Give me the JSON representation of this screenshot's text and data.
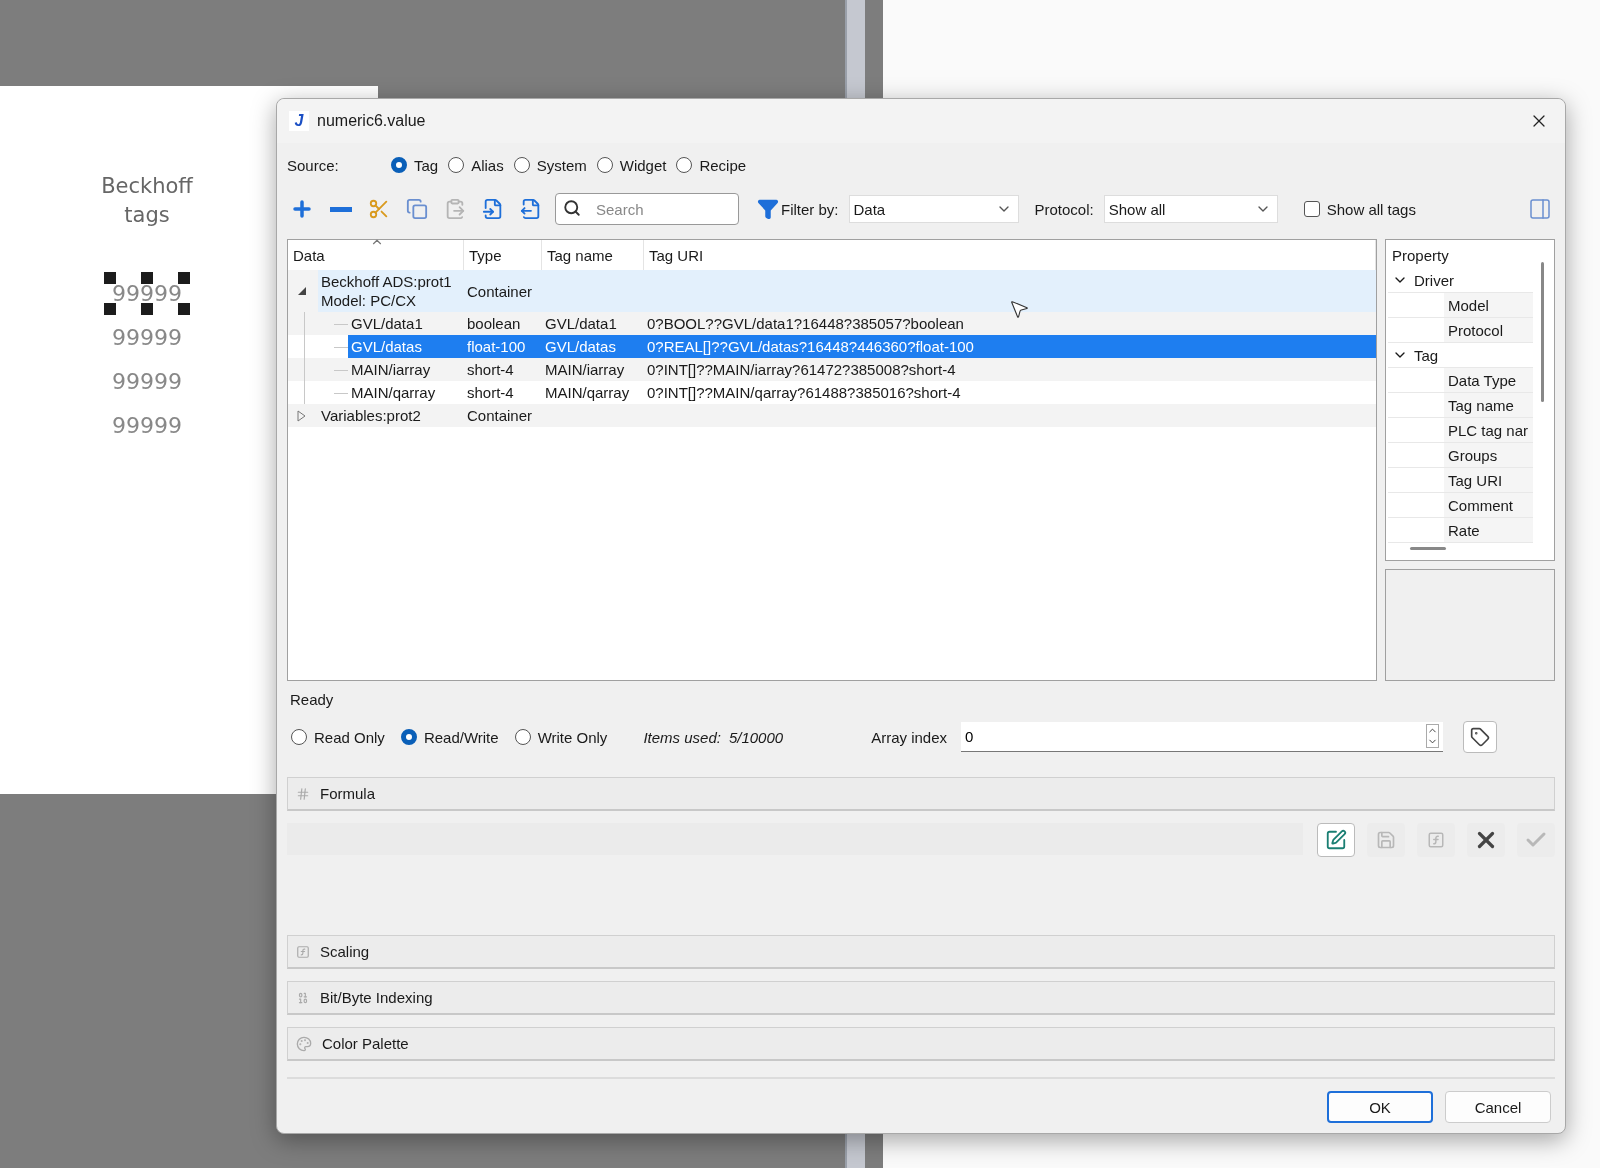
{
  "canvas": {
    "title": "Beckhoff tags",
    "values": [
      {
        "text": "99999",
        "selected": true
      },
      {
        "text": "99999",
        "selected": false
      },
      {
        "text": "99999",
        "selected": false
      },
      {
        "text": "99999",
        "selected": false
      }
    ]
  },
  "dialog": {
    "app_icon": "J",
    "title": "numeric6.value",
    "source": {
      "label": "Source:",
      "options": [
        {
          "label": "Tag",
          "selected": true
        },
        {
          "label": "Alias",
          "selected": false
        },
        {
          "label": "System",
          "selected": false
        },
        {
          "label": "Widget",
          "selected": false
        },
        {
          "label": "Recipe",
          "selected": false
        }
      ]
    },
    "toolbar": {
      "search": {
        "placeholder": "Search"
      },
      "filter": {
        "label": "Filter by:",
        "value": "Data"
      },
      "protocol": {
        "label": "Protocol:",
        "value": "Show all"
      },
      "show_all_tags": {
        "label": "Show all tags",
        "checked": false
      }
    },
    "tree": {
      "columns": [
        "Data",
        "Type",
        "Tag name",
        "Tag URI"
      ],
      "rows": [
        {
          "data": "Beckhoff ADS:prot1\nModel: PC/CX",
          "type": "Container",
          "tag_name": "",
          "tag_uri": "",
          "expanded": true,
          "selected": false,
          "hovered": true,
          "children": [
            {
              "data": "GVL/data1",
              "type": "boolean",
              "tag_name": "GVL/data1",
              "tag_uri": "0?BOOL??GVL/data1?16448?385057?boolean",
              "selected": false,
              "hovered": false
            },
            {
              "data": "GVL/datas",
              "type": "float-100",
              "tag_name": "GVL/datas",
              "tag_uri": "0?REAL[]??GVL/datas?16448?446360?float-100",
              "selected": true,
              "hovered": false
            },
            {
              "data": "MAIN/iarray",
              "type": "short-4",
              "tag_name": "MAIN/iarray",
              "tag_uri": "0?INT[]??MAIN/iarray?61472?385008?short-4",
              "selected": false,
              "hovered": false
            },
            {
              "data": "MAIN/qarray",
              "type": "short-4",
              "tag_name": "MAIN/qarray",
              "tag_uri": "0?INT[]??MAIN/qarray?61488?385016?short-4",
              "selected": false,
              "hovered": false
            }
          ]
        },
        {
          "data": "Variables:prot2",
          "type": "Container",
          "tag_name": "",
          "tag_uri": "",
          "expanded": false,
          "selected": false,
          "hovered": false,
          "children": []
        }
      ]
    },
    "properties": {
      "header": "Property",
      "groups": [
        {
          "label": "Driver",
          "expanded": true,
          "children": [
            "Model",
            "Protocol"
          ]
        },
        {
          "label": "Tag",
          "expanded": true,
          "children": [
            "Data Type",
            "Tag name",
            "PLC tag nar",
            "Groups",
            "Tag URI",
            "Comment",
            "Rate"
          ]
        }
      ]
    },
    "status": "Ready",
    "access": {
      "options": [
        {
          "label": "Read Only",
          "selected": false
        },
        {
          "label": "Read/Write",
          "selected": true
        },
        {
          "label": "Write Only",
          "selected": false
        }
      ],
      "items_used_label": "Items used:",
      "items_used": "5/10000",
      "array_index_label": "Array index",
      "array_index": "0"
    },
    "sections": [
      {
        "kind": "formula",
        "title": "Formula"
      },
      {
        "kind": "scaling",
        "title": "Scaling"
      },
      {
        "kind": "bits",
        "title": "Bit/Byte Indexing"
      },
      {
        "kind": "palette",
        "title": "Color Palette"
      }
    ],
    "formula_tools": [
      {
        "kind": "edit",
        "disabled": false
      },
      {
        "kind": "save",
        "disabled": true
      },
      {
        "kind": "function",
        "disabled": true
      },
      {
        "kind": "clear",
        "disabled": false
      },
      {
        "kind": "apply",
        "disabled": true
      }
    ],
    "buttons": [
      {
        "label": "OK",
        "default": true
      },
      {
        "label": "Cancel",
        "default": false
      }
    ]
  }
}
